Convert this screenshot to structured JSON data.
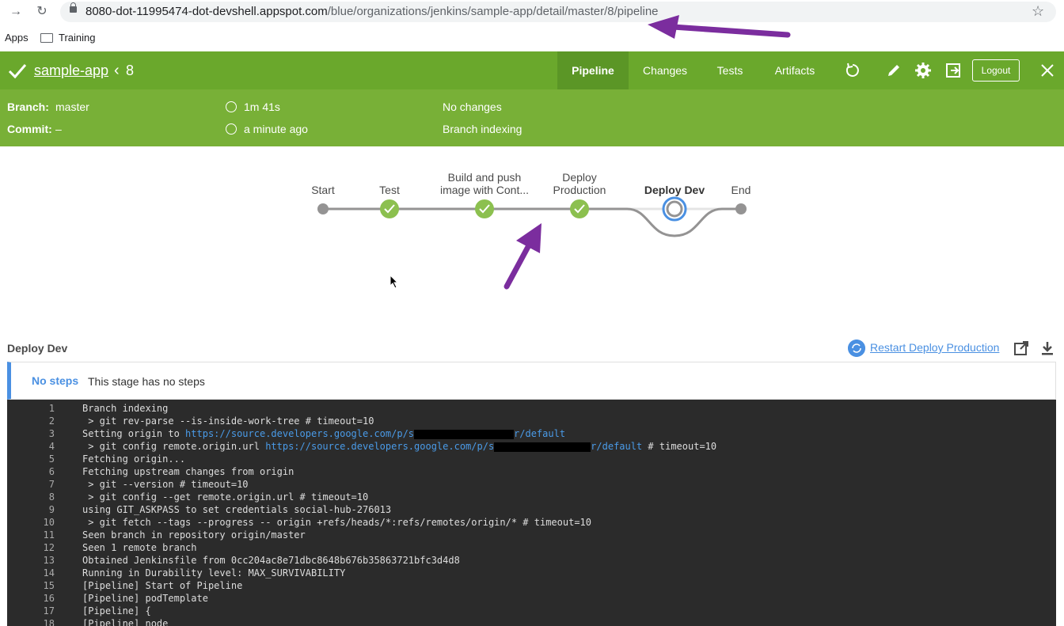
{
  "browser": {
    "url_host": "8080-dot-11995474-dot-devshell.appspot.com",
    "url_path": "/blue/organizations/jenkins/sample-app/detail/master/8/pipeline",
    "bookmarks": {
      "apps": "Apps",
      "training": "Training"
    }
  },
  "header": {
    "app_name": "sample-app",
    "run_number": "8",
    "tabs": [
      "Pipeline",
      "Changes",
      "Tests",
      "Artifacts"
    ],
    "active_tab": "Pipeline",
    "logout": "Logout",
    "color": "#6aa82c"
  },
  "summary": {
    "branch_label": "Branch:",
    "branch_value": "master",
    "commit_label": "Commit:",
    "commit_value": "–",
    "duration": "1m 41s",
    "when": "a minute ago",
    "changes": "No changes",
    "cause": "Branch indexing"
  },
  "pipeline": {
    "stages": [
      {
        "label_1": "Start",
        "label_2": "",
        "state": "start"
      },
      {
        "label_1": "Test",
        "label_2": "",
        "state": "success"
      },
      {
        "label_1": "Build and push",
        "label_2": "image with Cont...",
        "state": "success"
      },
      {
        "label_1": "Deploy",
        "label_2": "Production",
        "state": "success"
      },
      {
        "label_1": "Deploy Dev",
        "label_2": "",
        "state": "running"
      },
      {
        "label_1": "End",
        "label_2": "",
        "state": "end"
      }
    ]
  },
  "log_panel": {
    "stage_title": "Deploy Dev",
    "restart_label": "Restart Deploy Production",
    "no_steps": "No steps",
    "no_steps_msg": "This stage has no steps",
    "lines": [
      {
        "n": "1",
        "pre": "Branch indexing"
      },
      {
        "n": "2",
        "pre": " > git rev-parse --is-inside-work-tree # timeout=10"
      },
      {
        "n": "3",
        "pre": "Setting origin to ",
        "link1": "https://source.developers.google.com/p/s",
        "link2": "r/default",
        "post": ""
      },
      {
        "n": "4",
        "pre": " > git config remote.origin.url ",
        "link1": "https://source.developers.google.com/p/s",
        "link2": "r/default",
        "post": " # timeout=10"
      },
      {
        "n": "5",
        "pre": "Fetching origin..."
      },
      {
        "n": "6",
        "pre": "Fetching upstream changes from origin"
      },
      {
        "n": "7",
        "pre": " > git --version # timeout=10"
      },
      {
        "n": "8",
        "pre": " > git config --get remote.origin.url # timeout=10"
      },
      {
        "n": "9",
        "pre": "using GIT_ASKPASS to set credentials social-hub-276013"
      },
      {
        "n": "10",
        "pre": " > git fetch --tags --progress -- origin +refs/heads/*:refs/remotes/origin/* # timeout=10"
      },
      {
        "n": "11",
        "pre": "Seen branch in repository origin/master"
      },
      {
        "n": "12",
        "pre": "Seen 1 remote branch"
      },
      {
        "n": "13",
        "pre": "Obtained Jenkinsfile from 0cc204ac8e71dbc8648b676b35863721bfc3d4d8"
      },
      {
        "n": "14",
        "pre": "Running in Durability level: MAX_SURVIVABILITY"
      },
      {
        "n": "15",
        "pre": "[Pipeline] Start of Pipeline"
      },
      {
        "n": "16",
        "pre": "[Pipeline] podTemplate"
      },
      {
        "n": "17",
        "pre": "[Pipeline] {"
      },
      {
        "n": "18",
        "pre": "[Pipeline] node"
      }
    ]
  },
  "annotation_color": "#7b2d9e"
}
